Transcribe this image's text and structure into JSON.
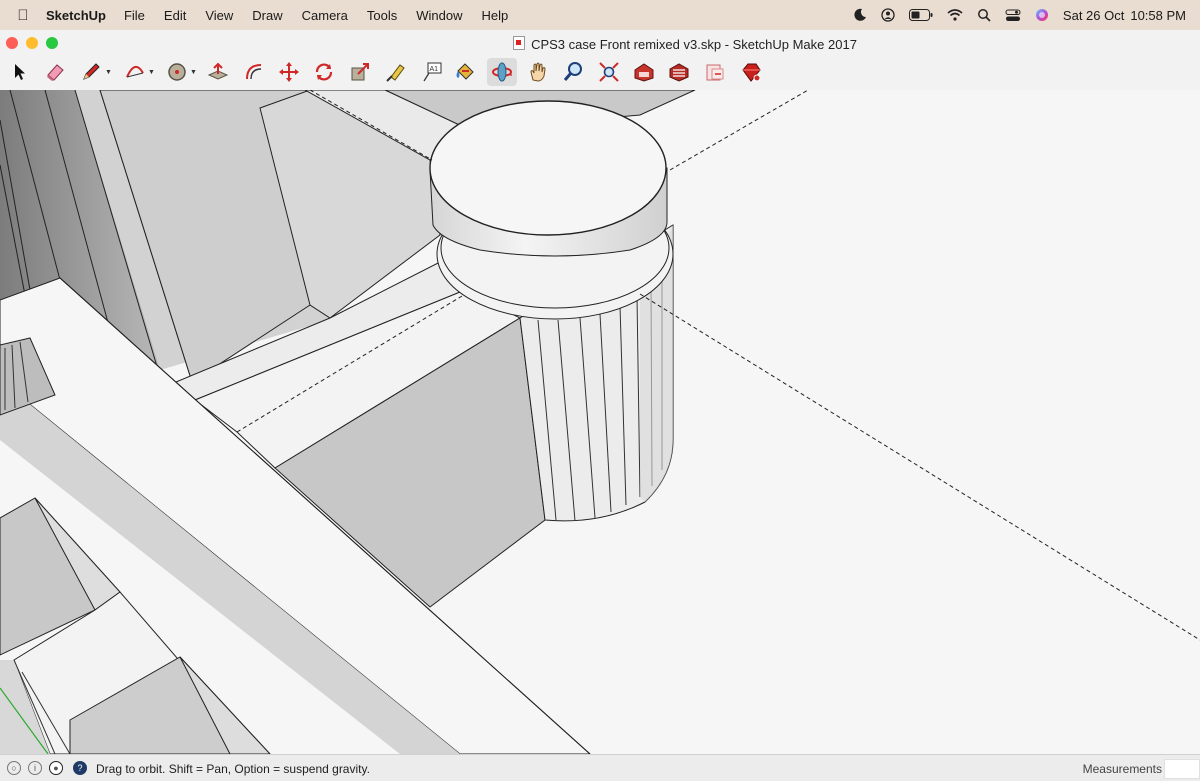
{
  "menubar": {
    "app_name": "SketchUp",
    "menus": [
      "File",
      "Edit",
      "View",
      "Draw",
      "Camera",
      "Tools",
      "Window",
      "Help"
    ],
    "date": "Sat 26 Oct",
    "time": "10:58 PM"
  },
  "window": {
    "title": "CPS3 case Front remixed v3.skp - SketchUp Make 2017"
  },
  "toolbar": {
    "tools": [
      {
        "name": "select",
        "icon": "arrow-cursor-icon"
      },
      {
        "name": "eraser",
        "icon": "eraser-icon"
      },
      {
        "name": "line",
        "icon": "pencil-icon"
      },
      {
        "name": "arc",
        "icon": "arc-icon"
      },
      {
        "name": "shapes",
        "icon": "circle-icon"
      },
      {
        "name": "push-pull",
        "icon": "push-pull-icon"
      },
      {
        "name": "offset",
        "icon": "offset-icon"
      },
      {
        "name": "move",
        "icon": "move-icon"
      },
      {
        "name": "rotate",
        "icon": "rotate-icon"
      },
      {
        "name": "scale",
        "icon": "scale-icon"
      },
      {
        "name": "tape-measure",
        "icon": "tape-measure-icon"
      },
      {
        "name": "text",
        "icon": "text-icon"
      },
      {
        "name": "paint-bucket",
        "icon": "paint-bucket-icon"
      },
      {
        "name": "orbit",
        "icon": "orbit-icon"
      },
      {
        "name": "pan",
        "icon": "hand-icon"
      },
      {
        "name": "zoom",
        "icon": "magnifier-icon"
      },
      {
        "name": "zoom-extents",
        "icon": "zoom-extents-icon"
      },
      {
        "name": "3d-warehouse",
        "icon": "warehouse-icon"
      },
      {
        "name": "extension-warehouse",
        "icon": "extension-icon"
      },
      {
        "name": "layout",
        "icon": "layout-icon"
      },
      {
        "name": "extension-manager",
        "icon": "ruby-icon"
      }
    ],
    "active_tool": "orbit",
    "text_tool_label": "A1"
  },
  "statusbar": {
    "hint": "Drag to orbit. Shift = Pan, Option = suspend gravity.",
    "help_glyph": "?",
    "measurements_label": "Measurements",
    "measurements_value": ""
  }
}
